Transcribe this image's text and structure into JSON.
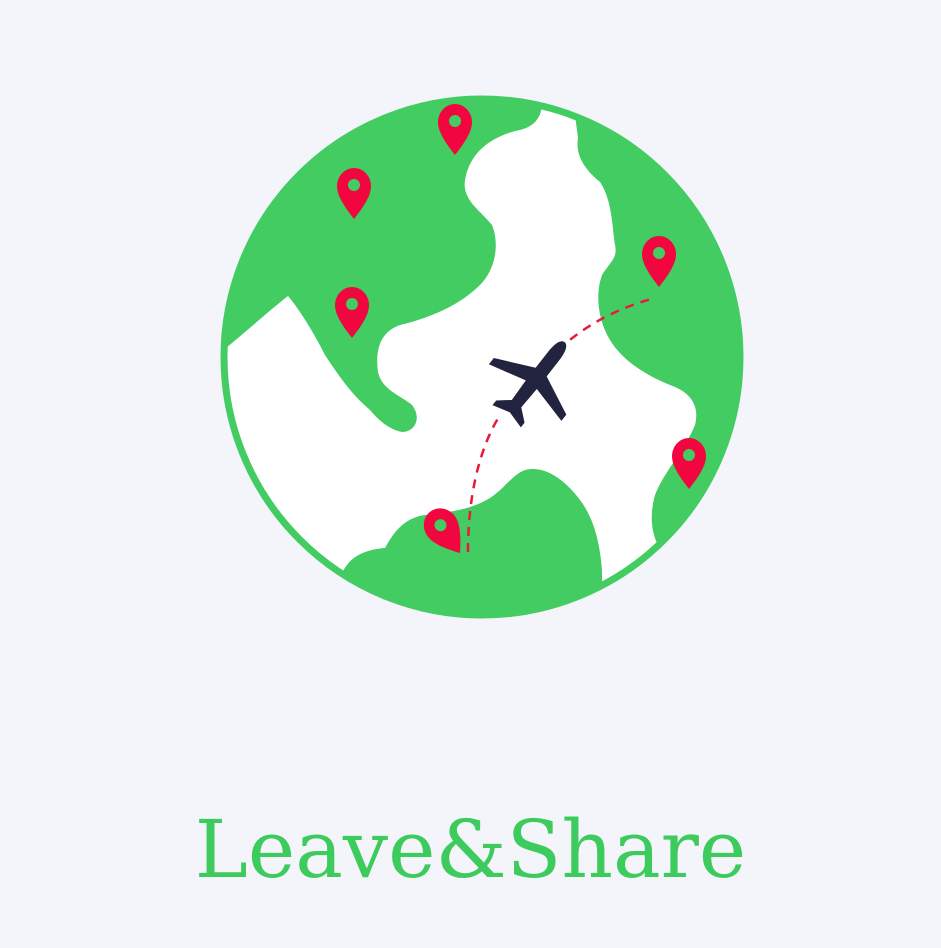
{
  "brand": {
    "name": "Leave&Share"
  },
  "colors": {
    "background": "#f3f5fa",
    "globe_green": "#42cc62",
    "globe_white": "#ffffff",
    "pin_red": "#f2063f",
    "plane_navy": "#22243f",
    "route_red": "#e8193c"
  },
  "icons": [
    "globe-icon",
    "map-pin-icon",
    "airplane-icon"
  ]
}
